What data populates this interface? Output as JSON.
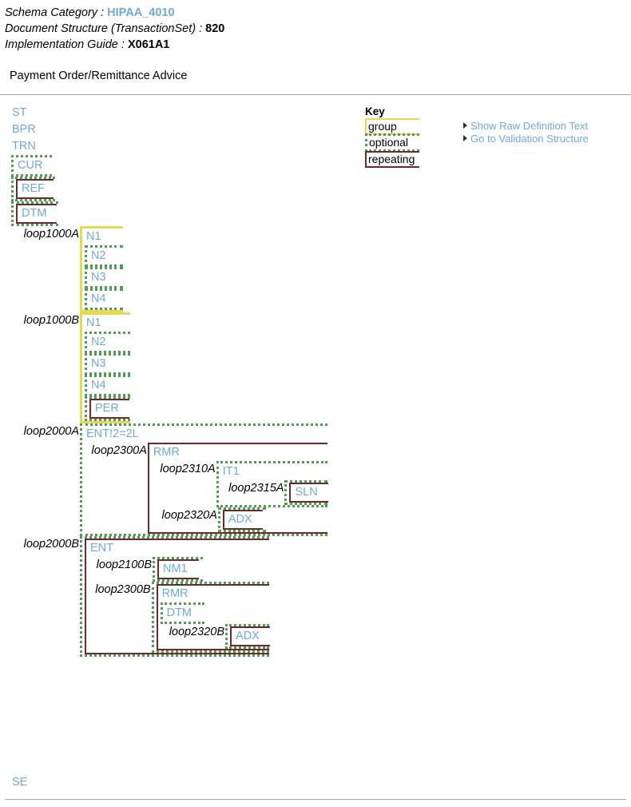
{
  "header": {
    "schema_category_label": "Schema Category :",
    "schema_category_value": "HIPAA_4010",
    "document_structure_label": "Document Structure (TransactionSet) :",
    "document_structure_value": "820",
    "implementation_guide_label": "Implementation Guide :",
    "implementation_guide_value": "X061A1",
    "doc_title": "Payment Order/Remittance Advice"
  },
  "key": {
    "title": "Key",
    "items": [
      {
        "label": "group",
        "color": "#e5d94f"
      },
      {
        "label": "optional",
        "color": "#4f9c52"
      },
      {
        "label": "repeating",
        "color": "#6b2a2f"
      }
    ]
  },
  "actions": [
    {
      "label": "Show Raw Definition Text"
    },
    {
      "label": "Go to Validation Structure"
    }
  ],
  "tree": {
    "st": "ST",
    "bpr": "BPR",
    "trn": "TRN",
    "cur": "CUR",
    "ref": "REF",
    "dtm": "DTM",
    "loop1000A": {
      "label": "loop1000A",
      "n1": "N1",
      "n2": "N2",
      "n3": "N3",
      "n4": "N4"
    },
    "loop1000B": {
      "label": "loop1000B",
      "n1": "N1",
      "n2": "N2",
      "n3": "N3",
      "n4": "N4",
      "per": "PER"
    },
    "loop2000A": {
      "label": "loop2000A",
      "ent": "ENT!2=2L",
      "loop2300A": {
        "label": "loop2300A",
        "rmr": "RMR",
        "loop2310A": {
          "label": "loop2310A",
          "it1": "IT1",
          "loop2315A": {
            "label": "loop2315A",
            "sln": "SLN"
          }
        },
        "loop2320A": {
          "label": "loop2320A",
          "adx": "ADX"
        }
      }
    },
    "loop2000B": {
      "label": "loop2000B",
      "ent": "ENT",
      "loop2100B": {
        "label": "loop2100B",
        "nm1": "NM1"
      },
      "loop2300B": {
        "label": "loop2300B",
        "rmr": "RMR",
        "dtm": "DTM",
        "loop2320B": {
          "label": "loop2320B",
          "adx": "ADX"
        }
      }
    },
    "se": "SE"
  },
  "colors": {
    "segment_text": "#6fa8dc",
    "link": "#6fa8dc",
    "group_border": "#e5d94f",
    "optional_border": "#4f9c52",
    "repeating_border": "#6b2a2f",
    "rule": "#a9a9a9"
  }
}
